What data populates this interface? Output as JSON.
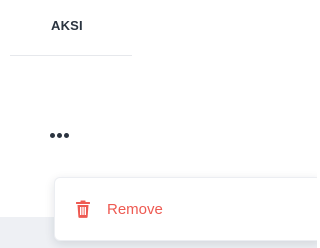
{
  "table": {
    "column_header": "AKSI"
  },
  "row": {
    "actions_icon": "more-horizontal-icon"
  },
  "menu": {
    "items": [
      {
        "label": "Remove",
        "icon": "trash-icon",
        "color": "#ee5a52"
      }
    ]
  },
  "colors": {
    "danger": "#ee5a52",
    "text_dark": "#2b3440",
    "divider": "#e6e8ec",
    "row_background": "#eef0f4"
  }
}
